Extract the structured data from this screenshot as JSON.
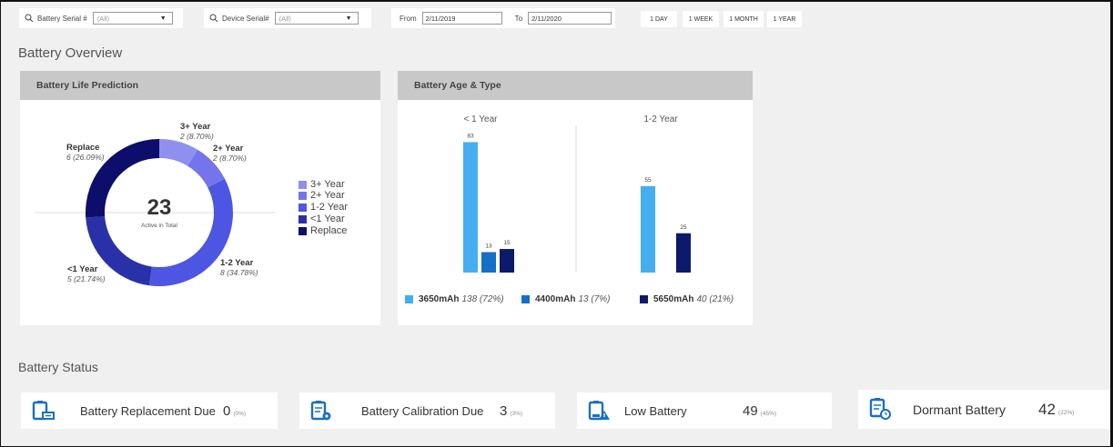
{
  "filters": {
    "battery_serial_label": "Battery Serial #",
    "battery_serial_value": "(All)",
    "device_serial_label": "Device Serial#",
    "device_serial_value": "(All)",
    "from_label": "From",
    "from_value": "2/11/2019",
    "to_label": "To",
    "to_value": "2/11/2020",
    "ranges": [
      "1 DAY",
      "1 WEEK",
      "1 MONTH",
      "1 YEAR"
    ]
  },
  "overview_title": "Battery Overview",
  "life_card": {
    "title": "Battery Life Prediction",
    "center_value": "23",
    "center_caption": "Active in Total",
    "legend": [
      "3+ Year",
      "2+ Year",
      "1-2 Year",
      "<1 Year",
      "Replace"
    ],
    "labels": [
      {
        "name": "3+ Year",
        "detail": "2 (8.70%)"
      },
      {
        "name": "2+ Year",
        "detail": "2 (8.70%)"
      },
      {
        "name": "1-2 Year",
        "detail": "8 (34.78%)"
      },
      {
        "name": "<1 Year",
        "detail": "5 (21.74%)"
      },
      {
        "name": "Replace",
        "detail": "6 (26.09%)"
      }
    ]
  },
  "age_card": {
    "title": "Battery Age & Type",
    "legend": [
      {
        "name": "3650mAh",
        "detail": "138 (72%)"
      },
      {
        "name": "4400mAh",
        "detail": "13 (7%)"
      },
      {
        "name": "5650mAh",
        "detail": "40 (21%)"
      }
    ]
  },
  "status_title": "Battery Status",
  "status_cards": [
    {
      "label": "Battery Replacement Due",
      "value": "0",
      "pct": "(0%)"
    },
    {
      "label": "Battery Calibration Due",
      "value": "3",
      "pct": "(3%)"
    },
    {
      "label": "Low Battery",
      "value": "49",
      "pct": "(45%)"
    },
    {
      "label": "Dormant Battery",
      "value": "42",
      "pct": "(22%)"
    }
  ],
  "colors": {
    "seg_3plus": "#8f8ff0",
    "seg_2plus": "#7474ec",
    "seg_1to2": "#4d55e3",
    "seg_lt1": "#2a31a8",
    "seg_replace": "#0d0d6b",
    "bar_3650": "#45aef1",
    "bar_4400": "#1370c6",
    "bar_5650": "#0b1a6b",
    "status_icon": "#1a6fc4"
  },
  "chart_data": [
    {
      "type": "pie",
      "title": "Battery Life Prediction",
      "categories": [
        "3+ Year",
        "2+ Year",
        "1-2 Year",
        "<1 Year",
        "Replace"
      ],
      "values": [
        2,
        2,
        8,
        5,
        6
      ],
      "legend": "right"
    },
    {
      "type": "bar",
      "title": "Battery Age & Type",
      "categories": [
        "< 1 Year",
        "1-2 Year"
      ],
      "series": [
        {
          "name": "3650mAh",
          "values": [
            83,
            55
          ]
        },
        {
          "name": "4400mAh",
          "values": [
            13,
            null
          ]
        },
        {
          "name": "5650mAh",
          "values": [
            15,
            25
          ]
        }
      ],
      "legend": "bottom"
    }
  ]
}
